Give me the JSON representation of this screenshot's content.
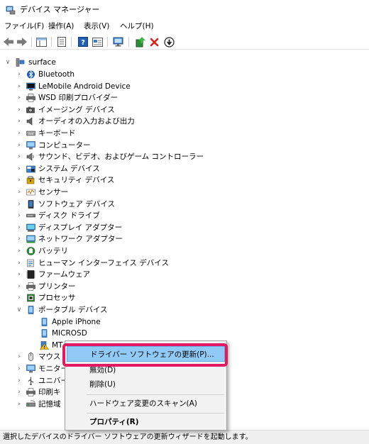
{
  "window": {
    "title": "デバイス マネージャー"
  },
  "menu": [
    {
      "label": "ファイル(F)"
    },
    {
      "label": "操作(A)"
    },
    {
      "label": "表示(V)"
    },
    {
      "label": "ヘルプ(H)"
    }
  ],
  "toolbar_icons": [
    "back-arrow-icon",
    "forward-arrow-icon",
    "properties-icon",
    "device-list-icon",
    "help-icon",
    "details-icon",
    "scan-monitor-icon",
    "update-driver-icon",
    "uninstall-x-icon",
    "disable-device-icon"
  ],
  "tree": {
    "root": "surface",
    "items": [
      {
        "label": "Bluetooth",
        "icon": "bluetooth-icon"
      },
      {
        "label": "LeMobile Android Device",
        "icon": "android-device-icon"
      },
      {
        "label": "WSD 印刷プロバイダー",
        "icon": "printer-icon"
      },
      {
        "label": "イメージング デバイス",
        "icon": "camera-icon"
      },
      {
        "label": "オーディオの入力および出力",
        "icon": "speaker-icon"
      },
      {
        "label": "キーボード",
        "icon": "keyboard-icon"
      },
      {
        "label": "コンピューター",
        "icon": "computer-icon"
      },
      {
        "label": "サウンド、ビデオ、およびゲーム コントローラー",
        "icon": "sound-icon"
      },
      {
        "label": "システム デバイス",
        "icon": "system-folder-icon"
      },
      {
        "label": "セキュリティ デバイス",
        "icon": "security-key-icon"
      },
      {
        "label": "センサー",
        "icon": "sensor-icon"
      },
      {
        "label": "ソフトウェア デバイス",
        "icon": "software-device-icon"
      },
      {
        "label": "ディスク ドライブ",
        "icon": "disk-drive-icon"
      },
      {
        "label": "ディスプレイ アダプター",
        "icon": "display-adapter-icon"
      },
      {
        "label": "ネットワーク アダプター",
        "icon": "network-adapter-icon"
      },
      {
        "label": "バッテリ",
        "icon": "battery-icon"
      },
      {
        "label": "ヒューマン インターフェイス デバイス",
        "icon": "hid-icon"
      },
      {
        "label": "ファームウェア",
        "icon": "firmware-icon"
      },
      {
        "label": "プリンター",
        "icon": "printer-icon"
      },
      {
        "label": "プロセッサ",
        "icon": "processor-icon"
      },
      {
        "label": "ポータブル デバイス",
        "icon": "portable-device-icon"
      },
      {
        "label": "Apple iPhone",
        "icon": "phone-icon"
      },
      {
        "label": "MICROSD",
        "icon": "phone-icon"
      },
      {
        "label": "MT",
        "icon": "warning-icon"
      },
      {
        "label": "マウス",
        "icon": "mouse-icon"
      },
      {
        "label": "モニター",
        "icon": "monitor-icon"
      },
      {
        "label": "ユニバー",
        "icon": "usb-icon"
      },
      {
        "label": "印刷キ",
        "icon": "print-queue-icon"
      },
      {
        "label": "記憶域",
        "icon": "storage-icon"
      }
    ]
  },
  "context_menu": {
    "update_driver": "ドライバー ソフトウェアの更新(P)...",
    "disable": "無効(D)",
    "uninstall": "削除(U)",
    "scan": "ハードウェア変更のスキャン(A)",
    "properties": "プロパティ(R)"
  },
  "status": "選択したデバイスのドライバー ソフトウェアの更新ウィザードを起動します。",
  "colors": {
    "highlight": "#91c9f7",
    "callout": "#e5195f",
    "warning": "#f2c200"
  }
}
